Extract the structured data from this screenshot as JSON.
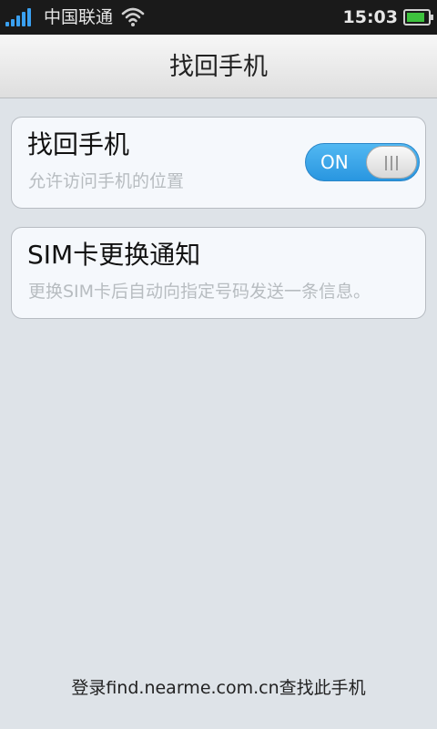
{
  "status_bar": {
    "carrier": "中国联通",
    "time": "15:03",
    "signal_icon": "signal-bars-icon",
    "wifi_icon": "wifi-icon",
    "battery_icon": "battery-icon",
    "battery_level": 0.85,
    "battery_color": "#3ec23e",
    "signal_color": "#3aa0f0"
  },
  "header": {
    "title": "找回手机"
  },
  "settings": [
    {
      "title": "找回手机",
      "subtitle": "允许访问手机的位置",
      "toggle": {
        "state": "on",
        "label": "ON"
      }
    },
    {
      "title": "SIM卡更换通知",
      "subtitle": "更换SIM卡后自动向指定号码发送一条信息。"
    }
  ],
  "footer": {
    "text": "登录find.nearme.com.cn查找此手机"
  },
  "colors": {
    "toggle_on": "#2996e0",
    "background": "#dee3e8"
  }
}
